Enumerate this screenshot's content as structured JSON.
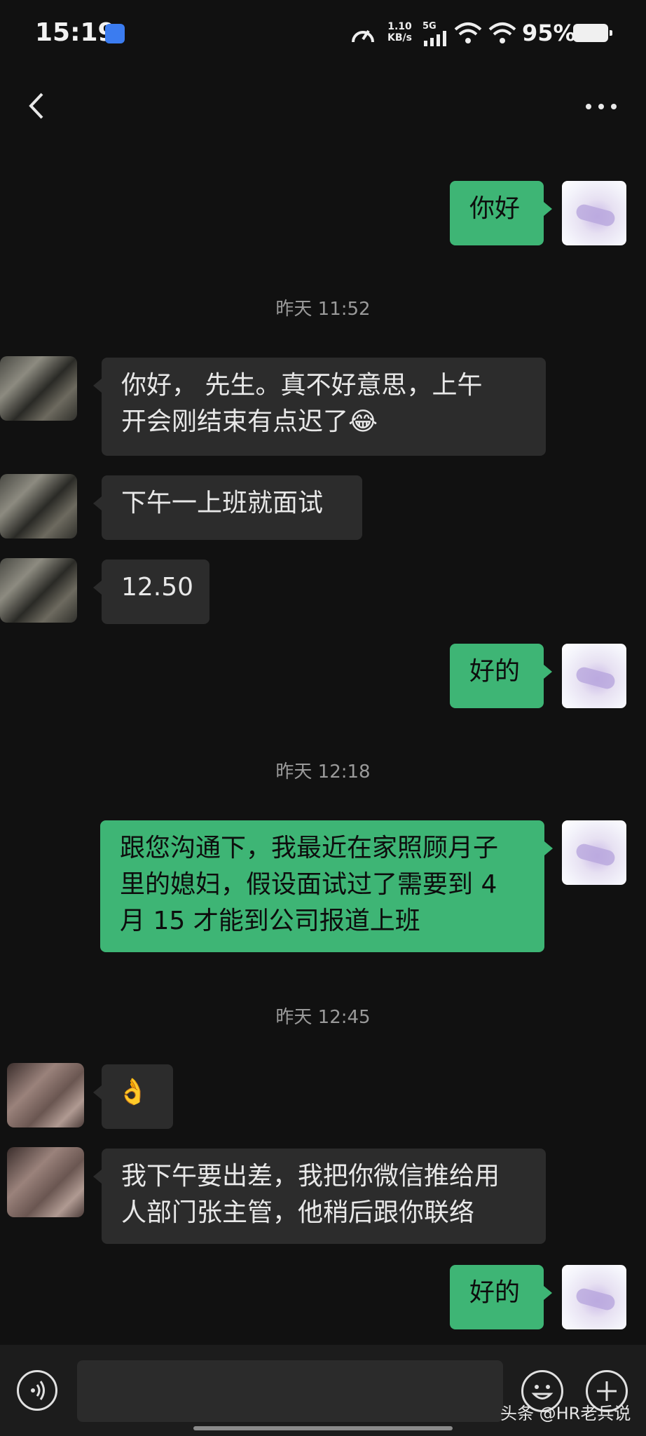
{
  "status_bar": {
    "time": "15:19",
    "net_speed_value": "1.10",
    "net_speed_unit": "KB/s",
    "network": "5G",
    "battery": "95%"
  },
  "chat": {
    "messages": [
      {
        "side": "out",
        "text": "你好"
      },
      {
        "type": "time",
        "text": "昨天 11:52"
      },
      {
        "side": "in",
        "line1": "你好， 先生。真不好意思，上午",
        "line2": "开会刚结束有点迟了",
        "emoji": "😂"
      },
      {
        "side": "in",
        "text": "下午一上班就面试"
      },
      {
        "side": "in",
        "text": "12.50"
      },
      {
        "side": "out",
        "text": "好的"
      },
      {
        "type": "time",
        "text": "昨天 12:18"
      },
      {
        "side": "out",
        "line1": "跟您沟通下，我最近在家照顾月子",
        "line2": "里的媳妇，假设面试过了需要到 4",
        "line3": "月 15 才能到公司报道上班"
      },
      {
        "type": "time",
        "text": "昨天 12:45"
      },
      {
        "side": "in",
        "emoji": "👌"
      },
      {
        "side": "in",
        "line1": "我下午要出差，我把你微信推给用",
        "line2": "人部门张主管，他稍后跟你联络"
      },
      {
        "side": "out",
        "text": "好的"
      }
    ]
  },
  "watermark": "头条 @HR老兵说",
  "colors": {
    "background": "#111111",
    "outgoing_bubble": "#3eb575",
    "incoming_bubble": "#2c2c2c",
    "timestamp": "#9a9a9a"
  },
  "icons": [
    "back-arrow-icon",
    "more-icon",
    "voice-icon",
    "emoji-icon",
    "plus-icon",
    "signal-icon",
    "wifi-icon",
    "battery-icon",
    "speedometer-icon"
  ]
}
